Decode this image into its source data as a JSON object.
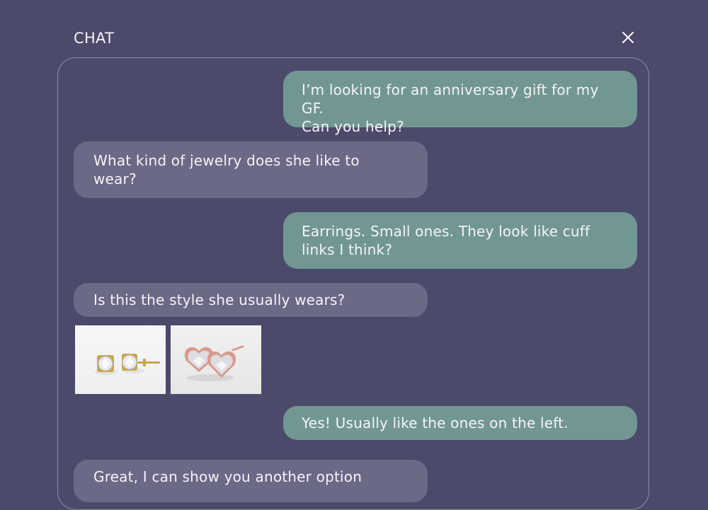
{
  "header": {
    "title": "CHAT",
    "close_icon": "close-icon"
  },
  "colors": {
    "background": "#4b4a6b",
    "user_bubble": "#729793",
    "bot_bubble": "#6a6986",
    "panel_border": "#8d8ca6"
  },
  "messages": [
    {
      "sender": "user",
      "text": "I’m looking for an anniversary gift for my GF.\nCan you help?"
    },
    {
      "sender": "bot",
      "text": "What kind of jewelry does she like to\nwear?"
    },
    {
      "sender": "user",
      "text": "Earrings. Small ones. They look like cuff\nlinks I think?"
    },
    {
      "sender": "bot",
      "text": "Is this the style she usually wears?"
    },
    {
      "sender": "user",
      "text": "Yes! Usually like the ones on the left."
    },
    {
      "sender": "bot",
      "text": "Great, I can show you another option"
    }
  ],
  "product_images": [
    {
      "icon": "gold-round-stud-earrings-image"
    },
    {
      "icon": "rose-gold-heart-stud-earrings-image"
    }
  ]
}
